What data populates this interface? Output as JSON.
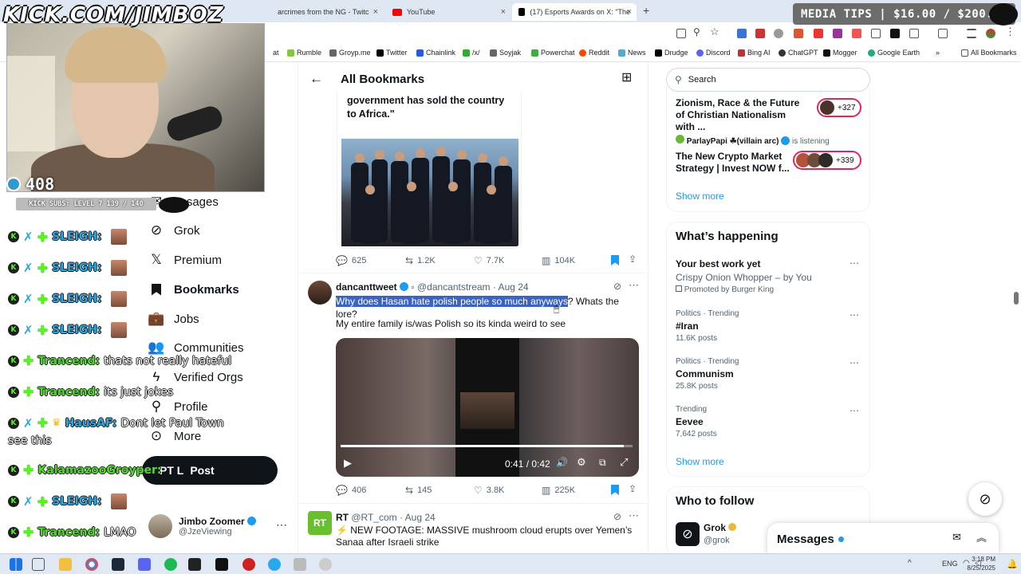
{
  "stream": {
    "channel_logo": "KICK.COM/JIMBOZ",
    "viewer_count": "408",
    "subs_bar": "KICK SUBS: LEVEL 7 139 / 140",
    "media_tips": "MEDIA TIPS | $16.00 / $200.00"
  },
  "browser": {
    "tabs": [
      {
        "title": "arcrimes from the NG - Twitc"
      },
      {
        "title": "YouTube"
      },
      {
        "title": "(17) Esports Awards on X: \"The"
      }
    ],
    "bookmarks": [
      "at",
      "Rumble",
      "Groyp.me",
      "Twitter",
      "Chainlink",
      "/x/",
      "Soyjak",
      "Powerchat",
      "Reddit",
      "News",
      "Drudge",
      "Discord",
      "Bing AI",
      "ChatGPT",
      "Mogger",
      "Google Earth"
    ],
    "all_bookmarks": "All Bookmarks"
  },
  "chat": [
    {
      "user": "SLEIGH:",
      "msg": ""
    },
    {
      "user": "SLEIGH:",
      "msg": ""
    },
    {
      "user": "SLEIGH:",
      "msg": ""
    },
    {
      "user": "SLEIGH:",
      "msg": ""
    },
    {
      "user": "Trancend:",
      "msg": "thats not really hateful"
    },
    {
      "user": "Trancend:",
      "msg": "its just jokes"
    },
    {
      "user": "HausAF:",
      "msg": "Dont let Paul Town",
      "msg2": "see this"
    },
    {
      "user": "KalamazooGroyper:",
      "msg": "PT L"
    },
    {
      "user": "SLEIGH:",
      "msg": ""
    },
    {
      "user": "Trancend:",
      "msg": "LMAO"
    }
  ],
  "nav": {
    "messages": "essages",
    "items": [
      "Grok",
      "Premium",
      "Bookmarks",
      "Jobs",
      "Communities",
      "Verified Orgs",
      "Profile",
      "More"
    ],
    "post": "Post",
    "account_name": "Jimbo Zoomer",
    "account_handle": "@JzeViewing"
  },
  "header": {
    "title": "All Bookmarks"
  },
  "tweet1": {
    "text": "government has sold the country to Africa.\"",
    "replies": "625",
    "reposts": "1.2K",
    "likes": "7.7K",
    "views": "104K"
  },
  "tweet2": {
    "name": "dancanttweet",
    "handle": "@dancantstream",
    "date": "· Aug 24",
    "highlight": "Why does Hasan hate polish people so much anyways",
    "rest": "? Whats the lore?",
    "line2": "My entire family is/was Polish so its kinda weird to see",
    "time": "0:41 / 0:42",
    "replies": "406",
    "reposts": "145",
    "likes": "3.8K",
    "views": "225K"
  },
  "tweet3": {
    "name": "RT",
    "handle": "@RT_com",
    "date": "· Aug 24",
    "text": "⚡ NEW FOOTAGE: MASSIVE mushroom cloud erupts over Yemen’s Sanaa after Israeli strike"
  },
  "right": {
    "search_placeholder": "Search",
    "spaces": [
      {
        "title": "Zionism, Race & the Future of Christian Nationalism with ...",
        "count": "+327"
      },
      {
        "host": "ParlayPapi ☘(villain arc)",
        "listening": "is listening",
        "title": "The New Crypto Market Strategy | Invest NOW f...",
        "count": "+339"
      }
    ],
    "show_more": "Show more",
    "whats_happening": "What’s happening",
    "ad": {
      "title": "Your best work yet",
      "sub": "Crispy Onion Whopper – by You",
      "promo": "Promoted by Burger King"
    },
    "trends": [
      {
        "meta": "Politics · Trending",
        "title": "#Iran",
        "posts": "11.6K posts"
      },
      {
        "meta": "Politics · Trending",
        "title": "Communism",
        "posts": "25.8K posts"
      },
      {
        "meta": "Trending",
        "title": "Eevee",
        "posts": "7,642 posts"
      }
    ],
    "show_more2": "Show more",
    "who_to_follow": "Who to follow",
    "follow": {
      "name": "Grok",
      "handle": "@grok"
    },
    "messages": "Messages"
  },
  "taskbar": {
    "lang": "ENG",
    "time": "3:18 PM",
    "date": "8/25/2025"
  }
}
